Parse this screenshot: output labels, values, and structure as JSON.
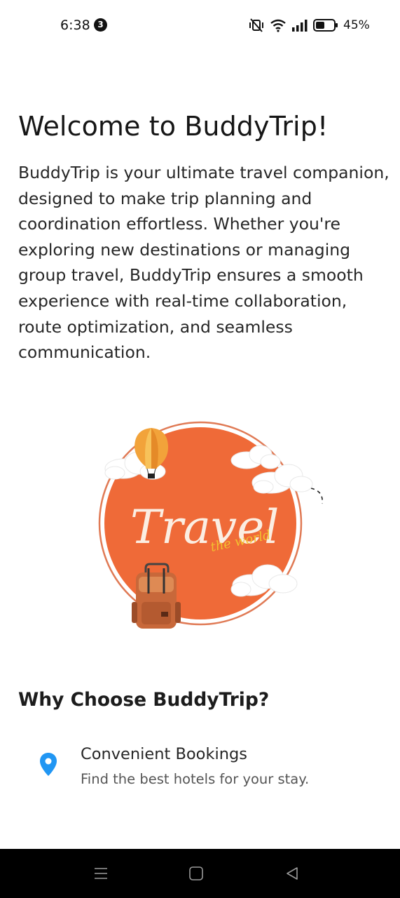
{
  "status_bar": {
    "time": "6:38",
    "notification_count": "3",
    "battery_percent": "45%"
  },
  "page": {
    "title": "Welcome to BuddyTrip!",
    "intro_lines": [
      "BuddyTrip is your ultimate travel companion,",
      "designed to make trip planning and",
      "coordination effortless. Whether you're",
      "exploring new destinations or managing",
      "group travel, BuddyTrip ensures a smooth",
      "experience with real-time collaboration,",
      "route optimization, and seamless",
      "communication."
    ],
    "logo": {
      "main_text": "Travel",
      "sub_text": "the world",
      "circle_color": "#ef6a38",
      "ring_color": "#e07a55",
      "script_color": "#fbeee2",
      "subscript_color": "#f2c230"
    },
    "why_title": "Why Choose BuddyTrip?",
    "features": [
      {
        "icon": "location-pin-icon",
        "title": "Convenient Bookings",
        "description": "Find the best hotels for your stay."
      }
    ],
    "accent_color": "#2196f3"
  },
  "nav_bar": {
    "buttons": [
      "menu-icon",
      "home-square-icon",
      "back-triangle-icon"
    ]
  }
}
